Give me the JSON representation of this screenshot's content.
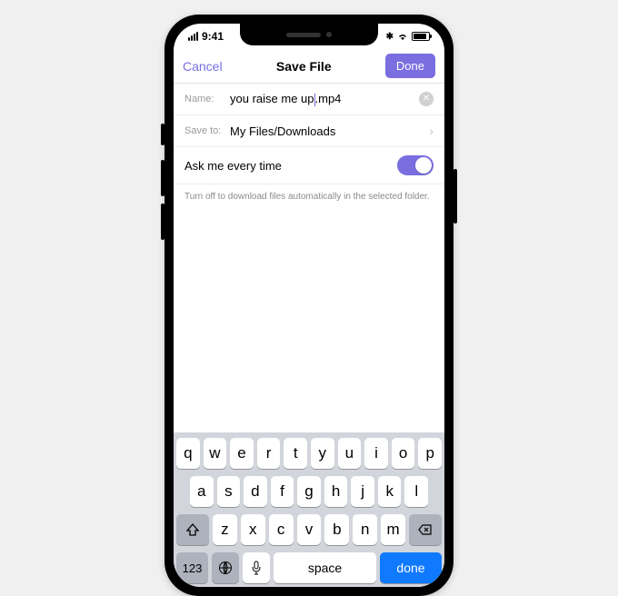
{
  "status": {
    "time": "9:41"
  },
  "navbar": {
    "cancel": "Cancel",
    "title": "Save File",
    "done": "Done"
  },
  "form": {
    "name_label": "Name:",
    "name_value_pre": "you raise me up",
    "name_value_post": ".mp4",
    "saveto_label": "Save to:",
    "saveto_value": "My Files/Downloads",
    "ask_label": "Ask me every time",
    "hint": "Turn off to download files automatically in the selected folder."
  },
  "keyboard": {
    "row1": [
      "q",
      "w",
      "e",
      "r",
      "t",
      "y",
      "u",
      "i",
      "o",
      "p"
    ],
    "row2": [
      "a",
      "s",
      "d",
      "f",
      "g",
      "h",
      "j",
      "k",
      "l"
    ],
    "row3": [
      "z",
      "x",
      "c",
      "v",
      "b",
      "n",
      "m"
    ],
    "k123": "123",
    "space": "space",
    "done": "done"
  }
}
